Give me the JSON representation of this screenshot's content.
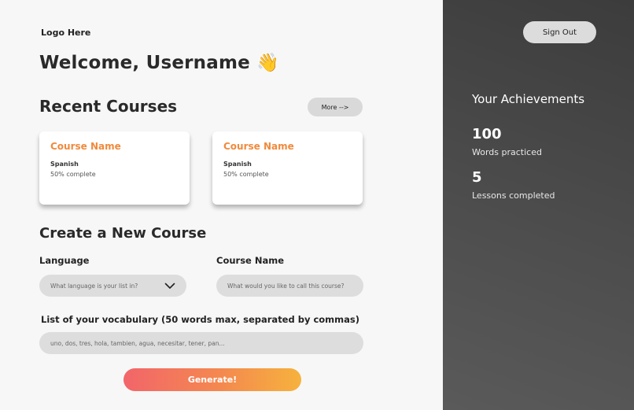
{
  "logo": "Logo Here",
  "welcome": "Welcome, Username",
  "recent": {
    "title": "Recent Courses",
    "more_label": "More -->",
    "courses": [
      {
        "name": "Course Name",
        "language": "Spanish",
        "progress": "50% complete"
      },
      {
        "name": "Course Name",
        "language": "Spanish",
        "progress": "50% complete"
      }
    ]
  },
  "create": {
    "title": "Create a New Course",
    "language_label": "Language",
    "language_placeholder": "What language is your list in?",
    "course_name_label": "Course Name",
    "course_name_placeholder": "What would you like to call this course?",
    "vocab_label": "List of your vocabulary (50 words max, separated by commas)",
    "vocab_placeholder": "uno, dos, tres, hola, tambien, agua, necesitar, tener, pan...",
    "generate_label": "Generate!"
  },
  "sidebar": {
    "sign_out_label": "Sign Out",
    "achievements_title": "Your Achievements",
    "stats": [
      {
        "value": "100",
        "label": "Words practiced"
      },
      {
        "value": "5",
        "label": "Lessons completed"
      }
    ]
  },
  "colors": {
    "accent": "#f08a3c",
    "gradient_start": "#f2656a",
    "gradient_end": "#f6b23d",
    "sidebar_bg": "#454545"
  }
}
